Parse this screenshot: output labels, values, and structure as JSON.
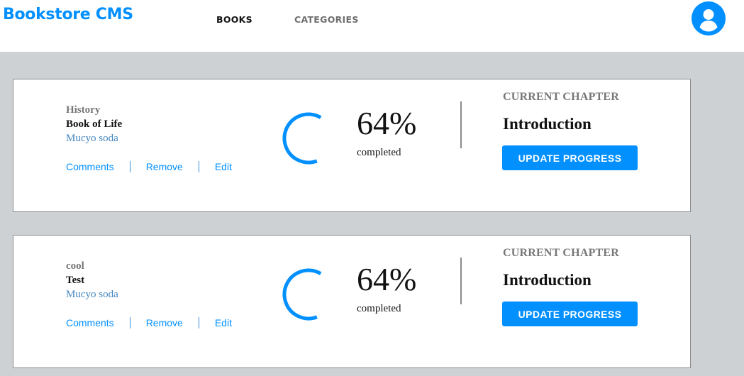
{
  "header": {
    "brand": "Bookstore CMS",
    "nav": [
      {
        "label": "BOOKS",
        "active": true
      },
      {
        "label": "CATEGORIES",
        "active": false
      }
    ],
    "avatar_icon": "user-avatar-icon"
  },
  "books": [
    {
      "category": "History",
      "title": "Book of Life",
      "author": "Mucyo soda",
      "actions": {
        "comments": "Comments",
        "remove": "Remove",
        "edit": "Edit"
      },
      "progress_percent": 64,
      "percent_label": "64%",
      "completed_label": "completed",
      "current_chapter_label": "CURRENT CHAPTER",
      "chapter": "Introduction",
      "update_button": "UPDATE PROGRESS"
    },
    {
      "category": "cool",
      "title": "Test",
      "author": "Mucyo soda",
      "actions": {
        "comments": "Comments",
        "remove": "Remove",
        "edit": "Edit"
      },
      "progress_percent": 64,
      "percent_label": "64%",
      "completed_label": "completed",
      "current_chapter_label": "CURRENT CHAPTER",
      "chapter": "Introduction",
      "update_button": "UPDATE PROGRESS"
    }
  ],
  "colors": {
    "accent": "#0290ff",
    "page_background": "#cdd1d4",
    "muted_text": "#777777",
    "author_link": "#4386bf"
  }
}
